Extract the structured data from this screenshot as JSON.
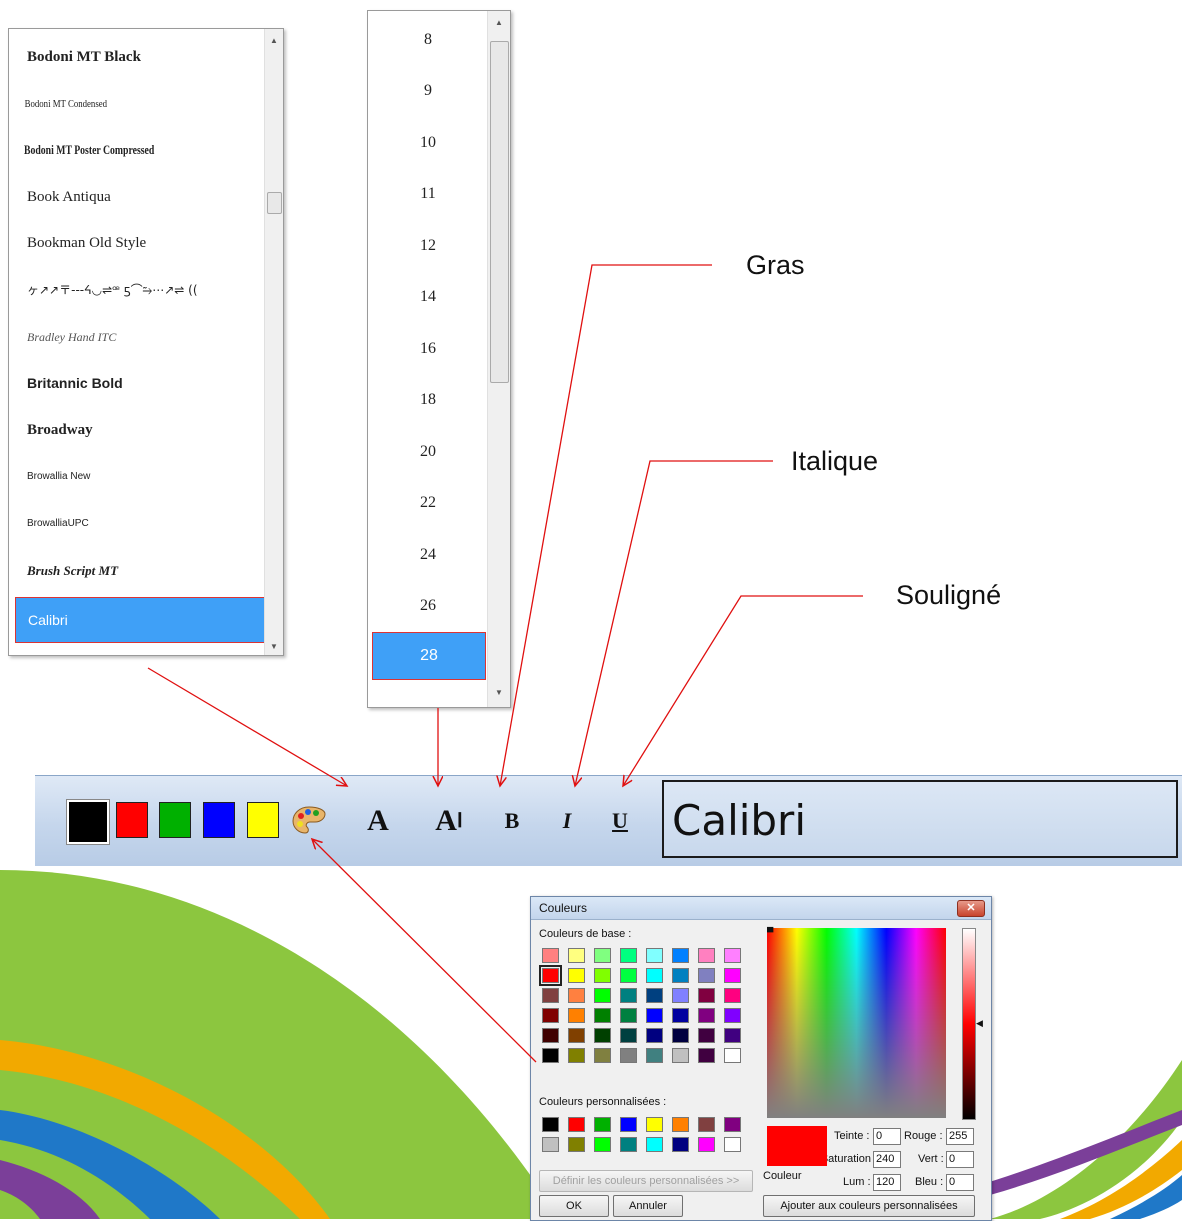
{
  "font_list": {
    "items": [
      {
        "label": "Bodoni MT Black"
      },
      {
        "label": "Bodoni MT Condensed"
      },
      {
        "label": "Bodoni MT Poster Compressed"
      },
      {
        "label": "Book Antiqua"
      },
      {
        "label": "Bookman Old Style"
      },
      {
        "label": "ヶ↗↗〒---ᔦ◡⇌ꟹ ƽ⌒⥲⋯↗⇌ (("
      },
      {
        "label": "Bradley Hand ITC"
      },
      {
        "label": "Britannic Bold"
      },
      {
        "label": "Broadway"
      },
      {
        "label": "Browallia New"
      },
      {
        "label": "BrowalliaUPC"
      },
      {
        "label": "Brush Script MT"
      },
      {
        "label": "Calibri"
      }
    ],
    "selected": "Calibri"
  },
  "size_list": {
    "items": [
      "8",
      "9",
      "10",
      "11",
      "12",
      "14",
      "16",
      "18",
      "20",
      "22",
      "24",
      "26",
      "28"
    ],
    "selected": "28"
  },
  "callouts": {
    "bold": "Gras",
    "italic": "Italique",
    "underline": "Souligné"
  },
  "toolbar": {
    "swatches": [
      "#000000",
      "#ff0000",
      "#00b000",
      "#0000ff",
      "#ffff00"
    ],
    "font_button": "A",
    "size_button": "A",
    "bold_button": "B",
    "italic_button": "I",
    "underline_button": "U",
    "font_preview": "Calibri"
  },
  "color_dialog": {
    "title": "Couleurs",
    "close": "✕",
    "basic_label": "Couleurs de base :",
    "custom_label": "Couleurs personnalisées :",
    "define_custom": "Définir les couleurs personnalisées >>",
    "ok": "OK",
    "cancel": "Annuler",
    "add_custom": "Ajouter aux couleurs personnalisées",
    "color_label": "Couleur",
    "hue_label": "Teinte :",
    "hue": "0",
    "sat_label": "Saturation",
    "sat": "240",
    "lum_label": "Lum :",
    "lum": "120",
    "red_label": "Rouge :",
    "red": "255",
    "green_label": "Vert :",
    "green": "0",
    "blue_label": "Bleu :",
    "blue": "0",
    "current_color": "#ff0000",
    "basic_colors": [
      [
        "#ff8080",
        "#ffff80",
        "#80ff80",
        "#00ff80",
        "#80ffff",
        "#0080ff",
        "#ff80c0",
        "#ff80ff"
      ],
      [
        "#ff0000",
        "#ffff00",
        "#80ff00",
        "#00ff40",
        "#00ffff",
        "#0080c0",
        "#8080c0",
        "#ff00ff"
      ],
      [
        "#804040",
        "#ff8040",
        "#00ff00",
        "#008080",
        "#004080",
        "#8080ff",
        "#800040",
        "#ff0080"
      ],
      [
        "#800000",
        "#ff8000",
        "#008000",
        "#008040",
        "#0000ff",
        "#0000a0",
        "#800080",
        "#8000ff"
      ],
      [
        "#400000",
        "#804000",
        "#004000",
        "#004040",
        "#000080",
        "#000040",
        "#400040",
        "#400080"
      ],
      [
        "#000000",
        "#808000",
        "#808040",
        "#808080",
        "#408080",
        "#c0c0c0",
        "#400040",
        "#ffffff"
      ]
    ],
    "custom_colors": [
      [
        "#000000",
        "#ff0000",
        "#00b000",
        "#0000ff",
        "#ffff00",
        "#ff8000",
        "#804040",
        "#800080"
      ],
      [
        "#c0c0c0",
        "#808000",
        "#00ff00",
        "#008080",
        "#00ffff",
        "#000080",
        "#ff00ff",
        "#ffffff"
      ]
    ]
  }
}
